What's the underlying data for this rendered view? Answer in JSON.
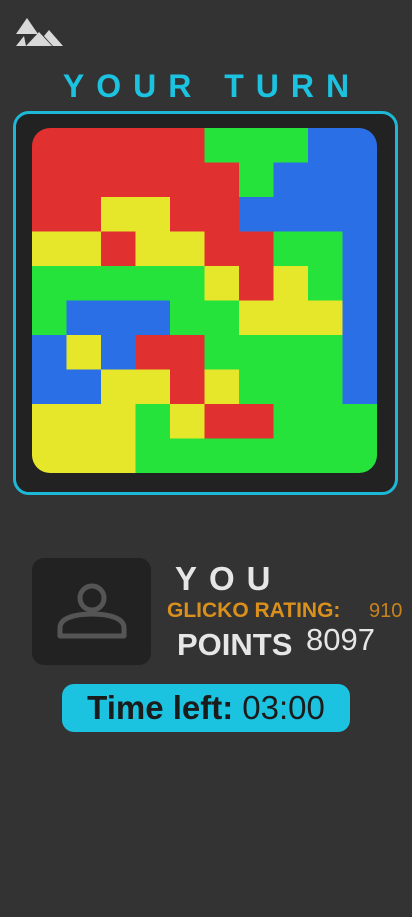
{
  "app": {
    "logo_icon": "mountain-triangles-icon",
    "turn_title": "YOUR TURN"
  },
  "board": {
    "size": 10,
    "colors": {
      "R": "#e03030",
      "G": "#26e33c",
      "B": "#2b6fe6",
      "Y": "#e6e62a"
    },
    "cells": [
      "RRRRRGGGBB",
      "RRRRRRGBBB",
      "RRYYRRBBBB",
      "YYRYYRRGGB",
      "GGGGGYRYGB",
      "GBBBGGYYYB",
      "BYBRRGGGGB",
      "BBYYRYGGGB",
      "YYYGYRRGGG",
      "YYYGGGGGGG"
    ]
  },
  "player": {
    "avatar_icon": "user-icon",
    "name": "YOU",
    "rating_label": "GLICKO RATING:",
    "rating_value": "910",
    "points_label": "POINTS",
    "points_value": "8097"
  },
  "timer": {
    "label": "Time left:",
    "value": "03:00"
  }
}
